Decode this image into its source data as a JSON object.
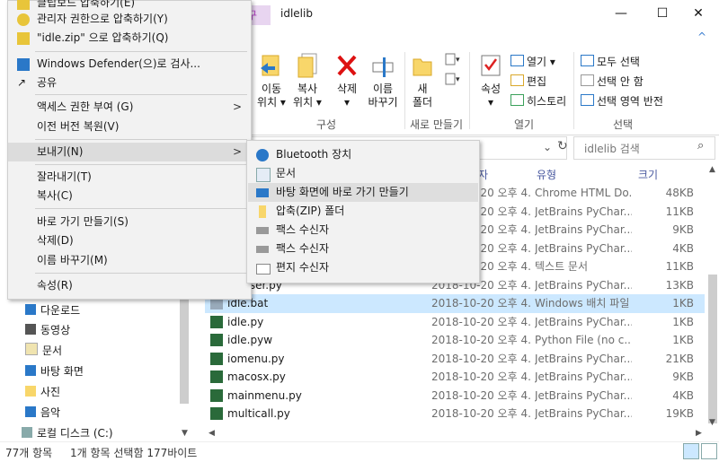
{
  "window": {
    "title": "idlelib",
    "context_tab": "구",
    "minimize": "—",
    "maximize": "☐",
    "close": "✕",
    "ribbon_toggle": "^"
  },
  "ribbon": {
    "organize": {
      "move_to": [
        "이동",
        "위치 ▾"
      ],
      "copy_to": [
        "복사",
        "위치 ▾"
      ],
      "delete": [
        "삭제",
        "▾"
      ],
      "rename": [
        "이름",
        "바꾸기"
      ],
      "group_label": "구성"
    },
    "new": {
      "new_folder": [
        "새",
        "폴더"
      ],
      "group_label": "새로 만들기"
    },
    "open": {
      "properties": [
        "속성",
        "▾"
      ],
      "open_label": "열기 ▾",
      "edit_label": "편집",
      "history_label": "히스토리",
      "group_label": "열기"
    },
    "select": {
      "select_all": "모두 선택",
      "select_none": "선택 안 함",
      "invert": "선택 영역 반전",
      "group_label": "선택"
    }
  },
  "address": {
    "dropdown": "⌄",
    "refresh": "↻"
  },
  "search": {
    "placeholder": "idlelib 검색"
  },
  "columns": {
    "date_partial": "자",
    "type": "유형",
    "size": "크기"
  },
  "files": [
    {
      "name": "",
      "date": "2018-10-20 오후 4...",
      "type": "Chrome HTML Do...",
      "size": "48KB",
      "icon": "chrome-html-icon"
    },
    {
      "name": "",
      "date": "2018-10-20 오후 4...",
      "type": "JetBrains PyChar...",
      "size": "11KB",
      "icon": "python-file-icon"
    },
    {
      "name": "",
      "date": "2018-10-20 오후 4...",
      "type": "JetBrains PyChar...",
      "size": "9KB",
      "icon": "python-file-icon"
    },
    {
      "name": "",
      "date": "2018-10-20 오후 4...",
      "type": "JetBrains PyChar...",
      "size": "4KB",
      "icon": "python-file-icon"
    },
    {
      "name": "",
      "date": "2018-10-20 오후 4...",
      "type": "텍스트 문서",
      "size": "11KB",
      "icon": "text-file-icon"
    },
    {
      "name": "rparser.py",
      "date": "2018-10-20 오후 4...",
      "type": "JetBrains PyChar...",
      "size": "13KB",
      "icon": "python-file-icon"
    },
    {
      "name": "idle.bat",
      "date": "2018-10-20 오후 4...",
      "type": "Windows 배치 파일",
      "size": "1KB",
      "icon": "batch-file-icon"
    },
    {
      "name": "idle.py",
      "date": "2018-10-20 오후 4...",
      "type": "JetBrains PyChar...",
      "size": "1KB",
      "icon": "python-file-icon"
    },
    {
      "name": "idle.pyw",
      "date": "2018-10-20 오후 4...",
      "type": "Python File (no c...",
      "size": "1KB",
      "icon": "python-file-icon"
    },
    {
      "name": "iomenu.py",
      "date": "2018-10-20 오후 4...",
      "type": "JetBrains PyChar...",
      "size": "21KB",
      "icon": "python-file-icon"
    },
    {
      "name": "macosx.py",
      "date": "2018-10-20 오후 4...",
      "type": "JetBrains PyChar...",
      "size": "9KB",
      "icon": "python-file-icon"
    },
    {
      "name": "mainmenu.py",
      "date": "2018-10-20 오후 4...",
      "type": "JetBrains PyChar...",
      "size": "4KB",
      "icon": "python-file-icon"
    },
    {
      "name": "multicall.py",
      "date": "2018-10-20 오후 4...",
      "type": "JetBrains PyChar...",
      "size": "19KB",
      "icon": "python-file-icon"
    }
  ],
  "nav": {
    "items": [
      "다운로드",
      "동영상",
      "문서",
      "바탕 화면",
      "사진",
      "음악",
      "로컬 디스크 (C:)"
    ]
  },
  "status": {
    "count": "77개 항목",
    "selection": "1개 항목 선택함 177바이트"
  },
  "context_menu": {
    "items": [
      "클립보드 압축하기(E)",
      "관리자 권한으로 압축하기(Y)",
      "\"idle.zip\" 으로 압축하기(Q)",
      "Windows Defender(으)로 검사...",
      "공유",
      "액세스 권한 부여 (G)",
      "이전 버전 복원(V)",
      "보내기(N)",
      "잘라내기(T)",
      "복사(C)",
      "바로 가기 만들기(S)",
      "삭제(D)",
      "이름 바꾸기(M)",
      "속성(R)"
    ],
    "arrow": ">"
  },
  "send_to_menu": {
    "items": [
      "Bluetooth 장치",
      "문서",
      "바탕 화면에 바로 가기 만들기",
      "압축(ZIP) 폴더",
      "팩스 수신자",
      "팩스 수신자",
      "편지 수신자"
    ]
  },
  "colors": {
    "selection": "#cce8ff",
    "menu_bg": "#f2f2f2",
    "accent": "#2a78c8"
  }
}
